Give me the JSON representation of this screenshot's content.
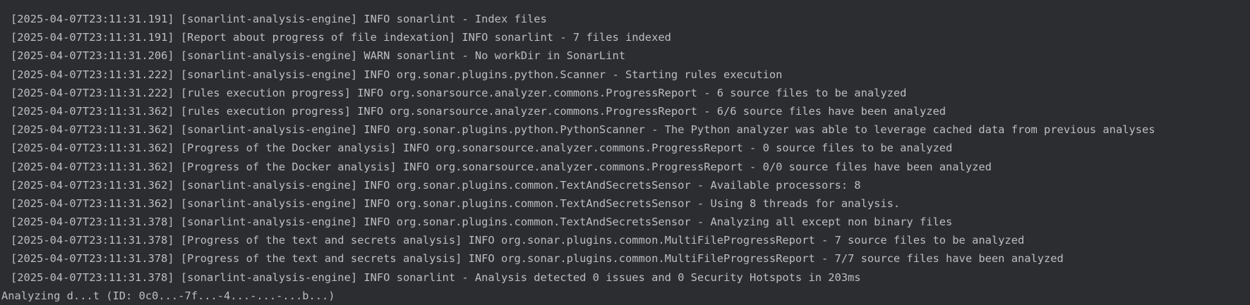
{
  "console": {
    "lines": [
      "[2025-04-07T23:11:31.191] [sonarlint-analysis-engine] INFO sonarlint - Index files",
      "[2025-04-07T23:11:31.191] [Report about progress of file indexation] INFO sonarlint - 7 files indexed",
      "[2025-04-07T23:11:31.206] [sonarlint-analysis-engine] WARN sonarlint - No workDir in SonarLint",
      "[2025-04-07T23:11:31.222] [sonarlint-analysis-engine] INFO org.sonar.plugins.python.Scanner - Starting rules execution",
      "[2025-04-07T23:11:31.222] [rules execution progress] INFO org.sonarsource.analyzer.commons.ProgressReport - 6 source files to be analyzed",
      "[2025-04-07T23:11:31.362] [rules execution progress] INFO org.sonarsource.analyzer.commons.ProgressReport - 6/6 source files have been analyzed",
      "[2025-04-07T23:11:31.362] [sonarlint-analysis-engine] INFO org.sonar.plugins.python.PythonScanner - The Python analyzer was able to leverage cached data from previous analyses",
      "[2025-04-07T23:11:31.362] [Progress of the Docker analysis] INFO org.sonarsource.analyzer.commons.ProgressReport - 0 source files to be analyzed",
      "[2025-04-07T23:11:31.362] [Progress of the Docker analysis] INFO org.sonarsource.analyzer.commons.ProgressReport - 0/0 source files have been analyzed",
      "[2025-04-07T23:11:31.362] [sonarlint-analysis-engine] INFO org.sonar.plugins.common.TextAndSecretsSensor - Available processors: 8",
      "[2025-04-07T23:11:31.362] [sonarlint-analysis-engine] INFO org.sonar.plugins.common.TextAndSecretsSensor - Using 8 threads for analysis.",
      "[2025-04-07T23:11:31.378] [sonarlint-analysis-engine] INFO org.sonar.plugins.common.TextAndSecretsSensor - Analyzing all except non binary files",
      "[2025-04-07T23:11:31.378] [Progress of the text and secrets analysis] INFO org.sonar.plugins.common.MultiFileProgressReport - 7 source files to be analyzed",
      "[2025-04-07T23:11:31.378] [Progress of the text and secrets analysis] INFO org.sonar.plugins.common.MultiFileProgressReport - 7/7 source files have been analyzed",
      "[2025-04-07T23:11:31.378] [sonarlint-analysis-engine] INFO sonarlint - Analysis detected 0 issues and 0 Security Hotspots in 203ms"
    ],
    "partial_line": "Analyzing d...t (ID: 0c0...-7f...-4...-...-...b...)"
  },
  "colors": {
    "background": "#2b2d30",
    "text": "#bcbec4"
  }
}
